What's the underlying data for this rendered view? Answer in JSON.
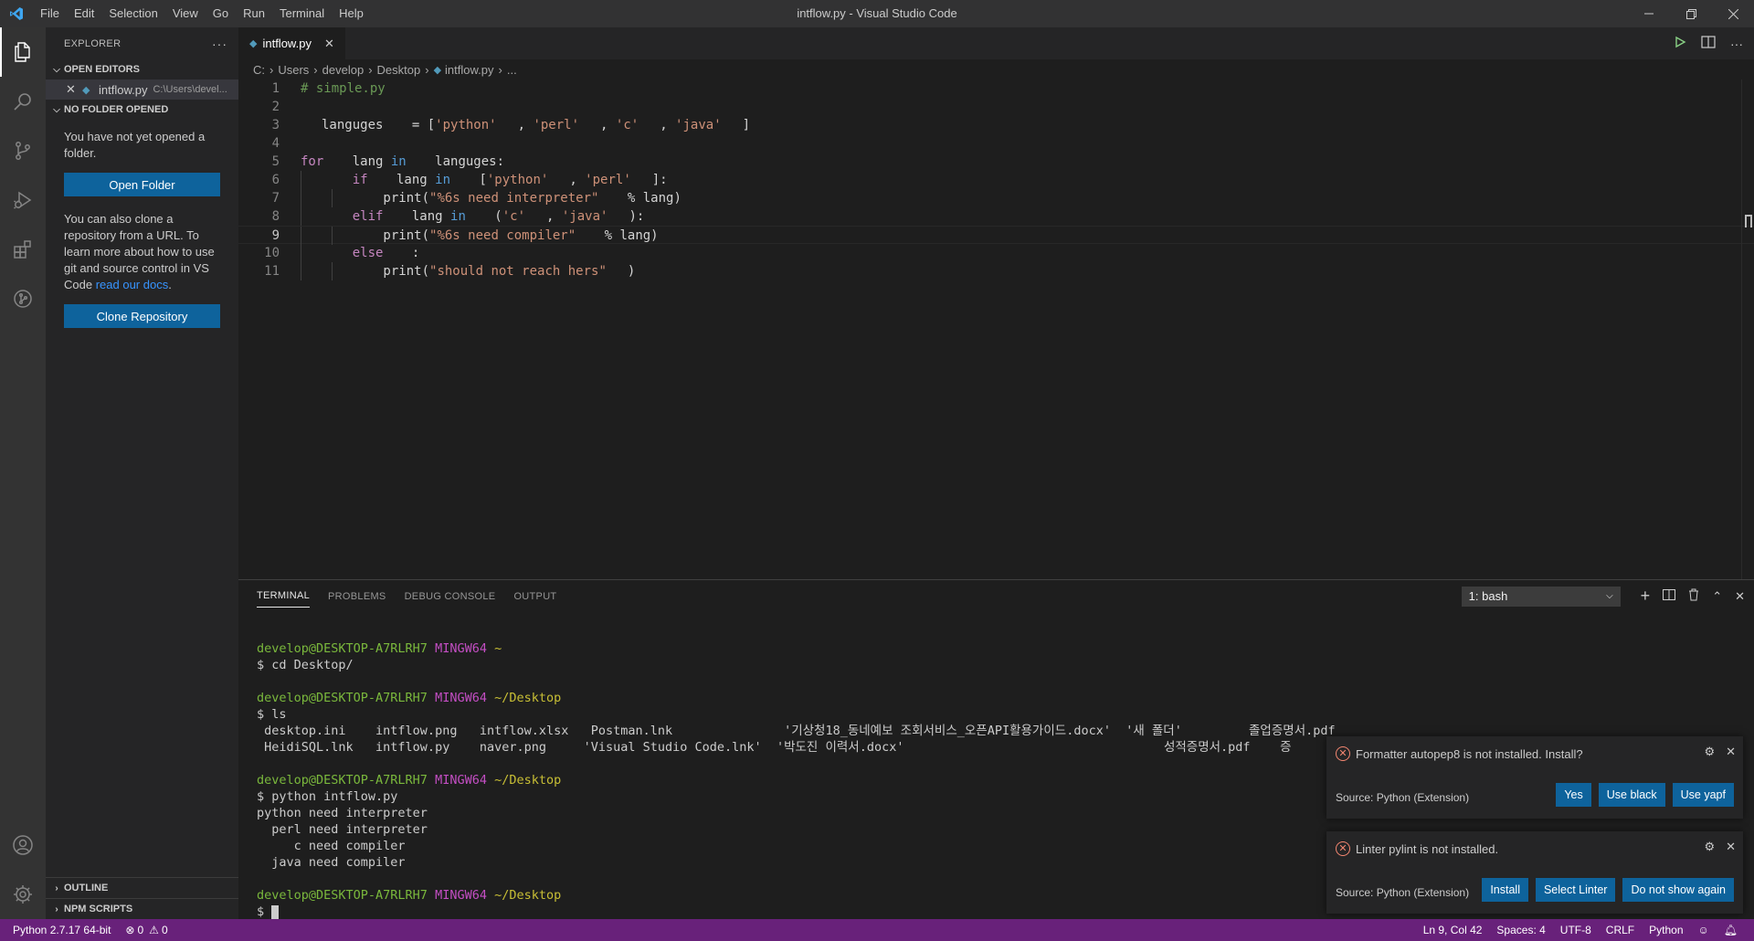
{
  "window": {
    "title": "intflow.py - Visual Studio Code"
  },
  "menu": [
    "File",
    "Edit",
    "Selection",
    "View",
    "Go",
    "Run",
    "Terminal",
    "Help"
  ],
  "sidebar": {
    "header": "EXPLORER",
    "open_editors_title": "OPEN EDITORS",
    "open_editor": {
      "name": "intflow.py",
      "path": "C:\\Users\\devel..."
    },
    "no_folder_title": "NO FOLDER OPENED",
    "no_folder_text": "You have not yet opened a folder.",
    "open_folder_button": "Open Folder",
    "clone_text": "You can also clone a repository from a URL. To learn more about how to use git and source control in VS Code ",
    "clone_link": "read our docs",
    "clone_text_end": ".",
    "clone_button": "Clone Repository",
    "outline_title": "OUTLINE",
    "npm_title": "NPM SCRIPTS"
  },
  "editor": {
    "tab_label": "intflow.py",
    "breadcrumb": [
      "C:",
      "Users",
      "develop",
      "Desktop",
      "intflow.py",
      "..."
    ],
    "active_line": 9,
    "lines": [
      [
        {
          "t": "# simple.py",
          "c": "cm"
        }
      ],
      [],
      [
        {
          "t": "languges",
          "c": "txt"
        },
        {
          "t": " = [",
          "c": "txt"
        },
        {
          "t": "'python'",
          "c": "str"
        },
        {
          "t": ", ",
          "c": "txt"
        },
        {
          "t": "'perl'",
          "c": "str"
        },
        {
          "t": ", ",
          "c": "txt"
        },
        {
          "t": "'c'",
          "c": "str"
        },
        {
          "t": ", ",
          "c": "txt"
        },
        {
          "t": "'java'",
          "c": "str"
        },
        {
          "t": "]",
          "c": "txt"
        }
      ],
      [],
      [
        {
          "t": "for",
          "c": "kw2"
        },
        {
          "t": " lang ",
          "c": "txt"
        },
        {
          "t": "in",
          "c": "kw"
        },
        {
          "t": " languges:",
          "c": "txt"
        }
      ],
      [
        {
          "t": "    ",
          "c": "txt"
        },
        {
          "t": "if",
          "c": "kw2"
        },
        {
          "t": " lang ",
          "c": "txt"
        },
        {
          "t": "in",
          "c": "kw"
        },
        {
          "t": " [",
          "c": "txt"
        },
        {
          "t": "'python'",
          "c": "str"
        },
        {
          "t": ", ",
          "c": "txt"
        },
        {
          "t": "'perl'",
          "c": "str"
        },
        {
          "t": "]:",
          "c": "txt"
        }
      ],
      [
        {
          "t": "        print(",
          "c": "txt"
        },
        {
          "t": "\"%6s need interpreter\"",
          "c": "str"
        },
        {
          "t": " % lang)",
          "c": "txt"
        }
      ],
      [
        {
          "t": "    ",
          "c": "txt"
        },
        {
          "t": "elif",
          "c": "kw2"
        },
        {
          "t": " lang ",
          "c": "txt"
        },
        {
          "t": "in",
          "c": "kw"
        },
        {
          "t": " (",
          "c": "txt"
        },
        {
          "t": "'c'",
          "c": "str"
        },
        {
          "t": ", ",
          "c": "txt"
        },
        {
          "t": "'java'",
          "c": "str"
        },
        {
          "t": "):",
          "c": "txt"
        }
      ],
      [
        {
          "t": "        print(",
          "c": "txt"
        },
        {
          "t": "\"%6s need compiler\"",
          "c": "str"
        },
        {
          "t": " % lang)",
          "c": "txt"
        }
      ],
      [
        {
          "t": "    ",
          "c": "txt"
        },
        {
          "t": "else",
          "c": "kw2"
        },
        {
          "t": " :",
          "c": "txt"
        }
      ],
      [
        {
          "t": "        print(",
          "c": "txt"
        },
        {
          "t": "\"should not reach hers\"",
          "c": "str"
        },
        {
          "t": ")",
          "c": "txt"
        }
      ]
    ]
  },
  "panel": {
    "tabs": [
      "TERMINAL",
      "PROBLEMS",
      "DEBUG CONSOLE",
      "OUTPUT"
    ],
    "terminal_select": "1: bash",
    "terminal_lines": [
      [],
      [
        {
          "t": "develop@DESKTOP-A7RLRH7 ",
          "c": "t-green"
        },
        {
          "t": "MINGW64 ",
          "c": "t-mag"
        },
        {
          "t": "~",
          "c": "t-yel"
        }
      ],
      [
        {
          "t": "$ cd Desktop/",
          "c": ""
        }
      ],
      [],
      [
        {
          "t": "develop@DESKTOP-A7RLRH7 ",
          "c": "t-green"
        },
        {
          "t": "MINGW64 ",
          "c": "t-mag"
        },
        {
          "t": "~/Desktop",
          "c": "t-yel"
        }
      ],
      [
        {
          "t": "$ ls",
          "c": ""
        }
      ],
      [
        {
          "t": " desktop.ini    intflow.png   intflow.xlsx   Postman.lnk               '기상청18_동네예보 조회서비스_오픈API활용가이드.docx'  '새 폴더'         졸업증명서.pdf",
          "c": ""
        }
      ],
      [
        {
          "t": " HeidiSQL.lnk   intflow.py    naver.png     'Visual Studio Code.lnk'  '박도진 이력서.docx'                                   성적증명서.pdf    증",
          "c": ""
        }
      ],
      [],
      [
        {
          "t": "develop@DESKTOP-A7RLRH7 ",
          "c": "t-green"
        },
        {
          "t": "MINGW64 ",
          "c": "t-mag"
        },
        {
          "t": "~/Desktop",
          "c": "t-yel"
        }
      ],
      [
        {
          "t": "$ python intflow.py",
          "c": ""
        }
      ],
      [
        {
          "t": "python need interpreter",
          "c": ""
        }
      ],
      [
        {
          "t": "  perl need interpreter",
          "c": ""
        }
      ],
      [
        {
          "t": "     c need compiler",
          "c": ""
        }
      ],
      [
        {
          "t": "  java need compiler",
          "c": ""
        }
      ],
      [],
      [
        {
          "t": "develop@DESKTOP-A7RLRH7 ",
          "c": "t-green"
        },
        {
          "t": "MINGW64 ",
          "c": "t-mag"
        },
        {
          "t": "~/Desktop",
          "c": "t-yel"
        }
      ],
      [
        {
          "t": "$ ",
          "c": ""
        },
        {
          "t": "",
          "c": "cursor"
        }
      ]
    ]
  },
  "notifications": [
    {
      "message": "Formatter autopep8 is not installed. Install?",
      "source": "Source: Python (Extension)",
      "buttons": [
        "Yes",
        "Use black",
        "Use yapf"
      ]
    },
    {
      "message": "Linter pylint is not installed.",
      "source": "Source: Python (Extension)",
      "buttons": [
        "Install",
        "Select Linter",
        "Do not show again"
      ]
    }
  ],
  "statusbar": {
    "interpreter": "Python 2.7.17 64-bit",
    "errors": "0",
    "warnings": "0",
    "position": "Ln 9, Col 42",
    "spaces": "Spaces: 4",
    "encoding": "UTF-8",
    "eol": "CRLF",
    "language": "Python"
  },
  "colors": {
    "statusbar_bg": "#68217a",
    "button_bg": "#0e639c",
    "accent_link": "#3794ff"
  }
}
